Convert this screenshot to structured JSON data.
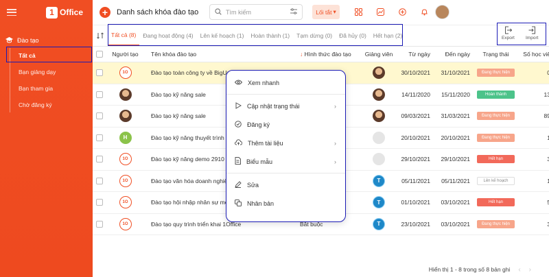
{
  "sidebar": {
    "logo_text": "Office",
    "logo_mark": "1",
    "section": "Đào tạo",
    "items": [
      "Tất cả",
      "Bạn giảng dạy",
      "Bạn tham gia",
      "Chờ đăng ký"
    ]
  },
  "header": {
    "title": "Danh sách khóa đào tạo",
    "search_placeholder": "Tìm kiếm",
    "shortcut_label": "Lối tắt"
  },
  "tabs": [
    "Tất cả (8)",
    "Đang hoạt động (4)",
    "Lên kế hoạch (1)",
    "Hoàn thành (1)",
    "Tạm dừng (0)",
    "Đã hủy (0)",
    "Hết hạn (2)"
  ],
  "actions": {
    "export": "Export",
    "import": "Import"
  },
  "columns": {
    "creator": "Người tạo",
    "name": "Tên khóa đào tạo",
    "type": "Hình thức đào tạo",
    "teacher": "Giảng viên",
    "from": "Từ ngày",
    "to": "Đến ngày",
    "status": "Trạng thái",
    "count": "Số học viê"
  },
  "rows": [
    {
      "creator": "logo",
      "name": "Đào tạo toàn công ty về BigUpda",
      "type": "",
      "teacher": "photo",
      "from": "30/10/2021",
      "to": "31/10/2021",
      "status": "Đang thực hiện",
      "status_kind": "progress",
      "count": "0"
    },
    {
      "creator": "photo",
      "name": "Đào tạo kỹ năng sale",
      "type": "",
      "teacher": "photo",
      "from": "14/11/2020",
      "to": "15/11/2020",
      "status": "Hoàn thành",
      "status_kind": "done",
      "count": "13"
    },
    {
      "creator": "photo",
      "name": "Đào tạo kỹ năng sale",
      "type": "",
      "teacher": "photo",
      "from": "09/03/2021",
      "to": "31/03/2021",
      "status": "Đang thực hiện",
      "status_kind": "progress",
      "count": "89"
    },
    {
      "creator": "H",
      "name": "Đào tạo kỹ năng thuyết trình",
      "type": "",
      "teacher": "empty",
      "from": "20/10/2021",
      "to": "20/10/2021",
      "status": "Đang thực hiện",
      "status_kind": "progress",
      "count": "1"
    },
    {
      "creator": "logo",
      "name": "Đào tạo kỹ năng demo 2910",
      "type": "",
      "teacher": "empty",
      "from": "29/10/2021",
      "to": "29/10/2021",
      "status": "Hết hạn",
      "status_kind": "expired",
      "count": "3"
    },
    {
      "creator": "logo",
      "name": "Đào tạo văn hóa doanh nghiệp - (",
      "type": "",
      "teacher": "T",
      "from": "05/11/2021",
      "to": "05/11/2021",
      "status": "Lên kế hoạch",
      "status_kind": "planned",
      "count": "1"
    },
    {
      "creator": "logo",
      "name": "Đào tạo hội nhập nhân sự mới tháng 10/2021",
      "type": "Bắt buộc",
      "teacher": "T",
      "from": "01/10/2021",
      "to": "03/10/2021",
      "status": "Hết hạn",
      "status_kind": "expired",
      "count": "5"
    },
    {
      "creator": "logo",
      "name": "Đào tạo quy trình triển khai 1Office",
      "type": "Bắt buộc",
      "teacher": "T",
      "from": "23/10/2021",
      "to": "03/10/2021",
      "status": "Đang thực hiện",
      "status_kind": "progress",
      "count": "3"
    }
  ],
  "context_menu": {
    "quick_view": "Xem nhanh",
    "update_status": "Cập nhật trạng thái",
    "register": "Đăng ký",
    "add_document": "Thêm tài liệu",
    "forms": "Biểu mẫu",
    "edit": "Sửa",
    "duplicate": "Nhân bản"
  },
  "footer": {
    "summary": "Hiển thị 1 - 8 trong số 8 bản ghi"
  },
  "colors": {
    "accent": "#f04e23",
    "highlight_box": "#1a1ab5"
  }
}
